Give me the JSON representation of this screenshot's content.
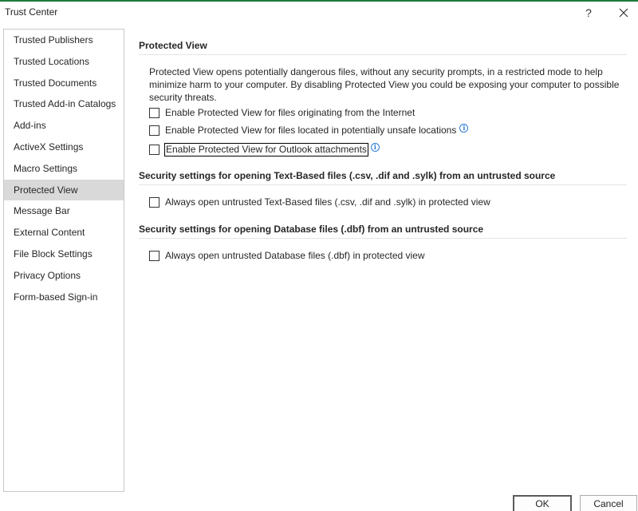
{
  "window": {
    "title": "Trust Center",
    "help_label": "?",
    "close_label": "✕"
  },
  "sidebar": {
    "items": [
      {
        "label": "Trusted Publishers"
      },
      {
        "label": "Trusted Locations"
      },
      {
        "label": "Trusted Documents"
      },
      {
        "label": "Trusted Add-in Catalogs"
      },
      {
        "label": "Add-ins"
      },
      {
        "label": "ActiveX Settings"
      },
      {
        "label": "Macro Settings"
      },
      {
        "label": "Protected View",
        "selected": true
      },
      {
        "label": "Message Bar"
      },
      {
        "label": "External Content"
      },
      {
        "label": "File Block Settings"
      },
      {
        "label": "Privacy Options"
      },
      {
        "label": "Form-based Sign-in"
      }
    ]
  },
  "main": {
    "protected_view": {
      "heading": "Protected View",
      "description": "Protected View opens potentially dangerous files, without any security prompts, in a restricted mode to help minimize harm to your computer. By disabling Protected View you could be exposing your computer to possible security threats.",
      "options": [
        {
          "label": "Enable Protected View for files originating from the Internet",
          "checked": false,
          "info": false
        },
        {
          "label": "Enable Protected View for files located in potentially unsafe locations",
          "checked": false,
          "info": true
        },
        {
          "label": "Enable Protected View for Outlook attachments",
          "checked": false,
          "info": true,
          "focused": true
        }
      ]
    },
    "text_based": {
      "heading": "Security settings for opening Text-Based files (.csv, .dif and .sylk) from an untrusted source",
      "option": {
        "label": "Always open untrusted Text-Based files (.csv, .dif and .sylk) in protected view",
        "checked": false
      }
    },
    "database": {
      "heading": "Security settings for opening Database files (.dbf) from an untrusted source",
      "option": {
        "label": "Always open untrusted Database files (.dbf) in protected view",
        "checked": false
      }
    }
  },
  "buttons": {
    "ok": "OK",
    "cancel": "Cancel"
  },
  "colors": {
    "accent_border": "#1f7a3a",
    "selected_bg": "#d9d9d9",
    "info_icon": "#2b7cd3"
  }
}
